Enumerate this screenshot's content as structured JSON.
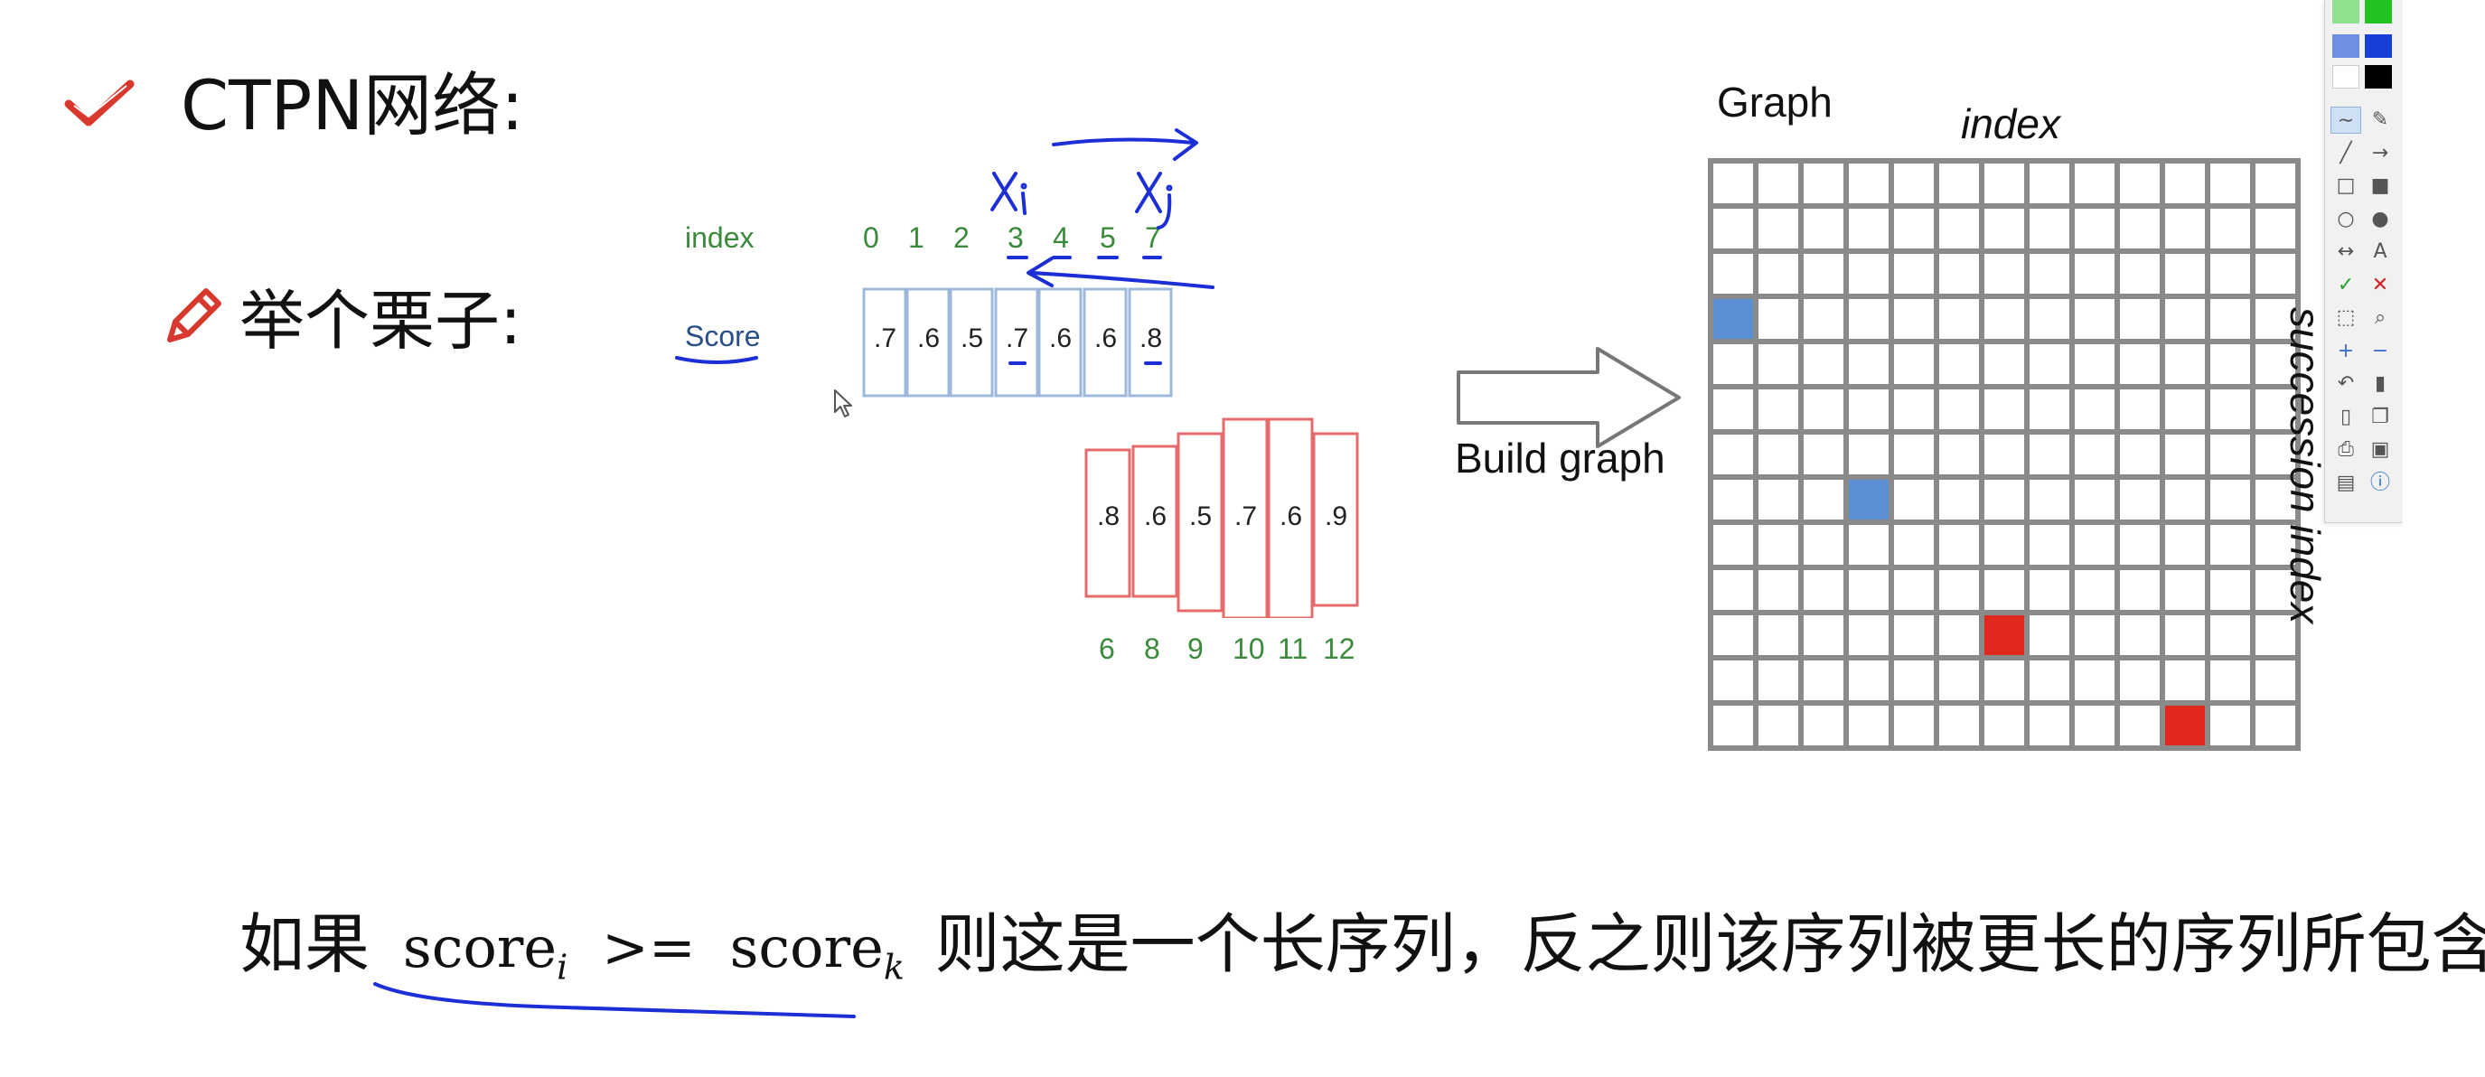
{
  "header": {
    "title": "CTPN网络:",
    "subtitle": "举个栗子:"
  },
  "icons": {
    "title_bullet": "check-icon",
    "subtitle_bullet": "pencil-icon",
    "cursor": "mouse-pointer-icon"
  },
  "example": {
    "index_label": "index",
    "score_label": "Score",
    "top_indices": [
      "0",
      "1",
      "2",
      "3",
      "4",
      "5",
      "7"
    ],
    "top_scores": [
      ".7",
      ".6",
      ".5",
      ".7",
      ".6",
      ".6",
      ".8"
    ],
    "bottom_scores": [
      ".8",
      ".6",
      ".5",
      ".7",
      ".6",
      ".9"
    ],
    "bottom_indices": [
      "6",
      "8",
      "9",
      "10",
      "11",
      "12"
    ],
    "handwritten_xi": "xi",
    "handwritten_xj": "xj",
    "arrow_label": "Build graph"
  },
  "graph": {
    "title": "Graph",
    "top_label": "index",
    "side_label": "succession index",
    "rows": 13,
    "cols": 13,
    "blue_cells": [
      [
        3,
        0
      ],
      [
        7,
        3
      ]
    ],
    "red_cells": [
      [
        10,
        6
      ],
      [
        12,
        10
      ]
    ]
  },
  "conclusion": {
    "prefix": "如果",
    "formula_left": "score",
    "sub_i": "i",
    "operator": ">=",
    "formula_right": "score",
    "sub_k": "k",
    "suffix": "则这是一个长序列，反之则该序列被更长的序列所包含。"
  },
  "toolbar": {
    "tools": [
      "pen-icon",
      "eraser-icon",
      "line-icon",
      "arrow-icon",
      "rect-icon",
      "filled-rect-icon",
      "ellipse-icon",
      "filled-ellipse-icon",
      "double-arrow-icon",
      "text-icon",
      "check-mark-icon",
      "delete-mark-icon",
      "select-icon",
      "zoom-icon",
      "plus-icon",
      "minus-icon",
      "undo-icon",
      "trash-icon",
      "new-page-icon",
      "copy-icon",
      "print-icon",
      "save-icon",
      "screenshot-icon",
      "info-icon"
    ],
    "text_tool_label": "A",
    "colors": [
      "#8fe08f",
      "#22c222",
      "#6f8fe0",
      "#1a3fd8",
      "#ffffff",
      "#000000"
    ]
  },
  "colors": {
    "blue_cell": "#5b8fd4",
    "red_cell": "#e0291c",
    "ink_blue": "#1c2fd6",
    "red_bullet": "#d9382e",
    "green_index": "#3b8a3b"
  }
}
